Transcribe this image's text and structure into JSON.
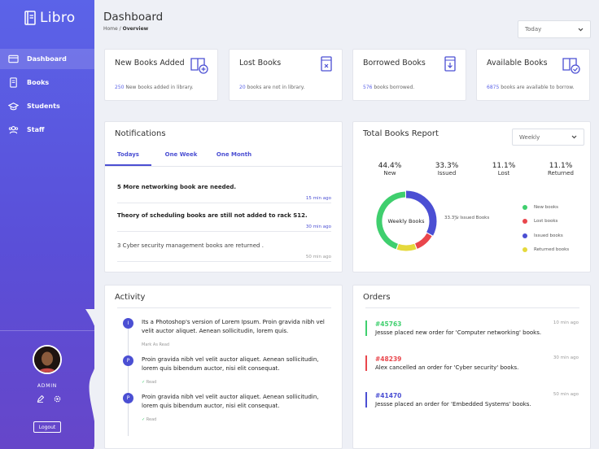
{
  "app": {
    "name": "Libro"
  },
  "sidebar": {
    "items": [
      {
        "label": "Dashboard",
        "icon": "card-icon",
        "active": true
      },
      {
        "label": "Books",
        "icon": "book-icon"
      },
      {
        "label": "Students",
        "icon": "graduation-cap-icon"
      },
      {
        "label": "Staff",
        "icon": "users-icon"
      }
    ],
    "user_role": "ADMIN",
    "logout_label": "Logout"
  },
  "header": {
    "title": "Dashboard",
    "breadcrumb": {
      "home": "Home",
      "sep": "/",
      "current": "Overview"
    },
    "period_select": "Today"
  },
  "stats": [
    {
      "title": "New Books Added",
      "value": "250",
      "text": "New books added in library."
    },
    {
      "title": "Lost Books",
      "value": "20",
      "text": "books are not in library."
    },
    {
      "title": "Borrowed Books",
      "value": "576",
      "text": "books borrowed."
    },
    {
      "title": "Available Books",
      "value": "6875",
      "text": "books are available to borrow."
    }
  ],
  "notifications": {
    "title": "Notifications",
    "tabs": [
      "Todays",
      "One Week",
      "One Month"
    ],
    "items": [
      {
        "text": "5 More networking book are needed.",
        "time": "15 min ago"
      },
      {
        "text": "Theory of scheduling books are still not added to rack S12.",
        "time": "30 min ago"
      },
      {
        "text": "3 Cyber security management books are returned .",
        "time": "50 min ago"
      }
    ]
  },
  "report": {
    "title": "Total Books Report",
    "period_select": "Weekly",
    "stats": [
      {
        "pct": "44.4%",
        "label": "New"
      },
      {
        "pct": "33.3%",
        "label": "Issued"
      },
      {
        "pct": "11.1%",
        "label": "Lost"
      },
      {
        "pct": "11.1%",
        "label": "Returned"
      }
    ],
    "donut_label": "Weekly Books",
    "callout": "33.3% Issued Books",
    "legend": [
      {
        "label": "New books",
        "color": "#3fcf6e"
      },
      {
        "label": "Lost books",
        "color": "#e9464c"
      },
      {
        "label": "Issued books",
        "color": "#4b4fd3"
      },
      {
        "label": "Returned books",
        "color": "#e5d93c"
      }
    ]
  },
  "chart_data": {
    "type": "pie",
    "categories": [
      "New",
      "Issued",
      "Lost",
      "Returned"
    ],
    "values": [
      44.4,
      33.3,
      11.1,
      11.1
    ],
    "title": "Total Books Report",
    "colors": [
      "#3fcf6e",
      "#4b4fd3",
      "#e9464c",
      "#e5d93c"
    ]
  },
  "activity": {
    "title": "Activity",
    "items": [
      {
        "badge": "I",
        "text": "Its a Photoshop's version  of Lorem Ipsum. Proin gravida nibh vel velit auctor aliquet. Aenean sollicitudin, lorem quis.",
        "status": "Mark As Read"
      },
      {
        "badge": "P",
        "text": "Proin gravida nibh vel velit auctor aliquet. Aenean sollicitudin, lorem quis bibendum auctor, nisi elit consequat.",
        "status": "Read"
      },
      {
        "badge": "P",
        "text": "Proin gravida nibh vel velit auctor aliquet. Aenean sollicitudin, lorem quis bibendum auctor, nisi elit consequat.",
        "status": "Read"
      }
    ]
  },
  "orders": {
    "title": "Orders",
    "items": [
      {
        "id": "#45763",
        "text": "Jessse placed new order for 'Computer networking' books.",
        "time": "10 min ago",
        "color": "#3fcf6e"
      },
      {
        "id": "#48239",
        "text": "Alex cancelled an order for 'Cyber security' books.",
        "time": "30 min ago",
        "color": "#e9464c"
      },
      {
        "id": "#41470",
        "text": "Jessse placed an order for 'Embedded Systems' books.",
        "time": "50 min ago",
        "color": "#4b4fd3"
      }
    ]
  }
}
